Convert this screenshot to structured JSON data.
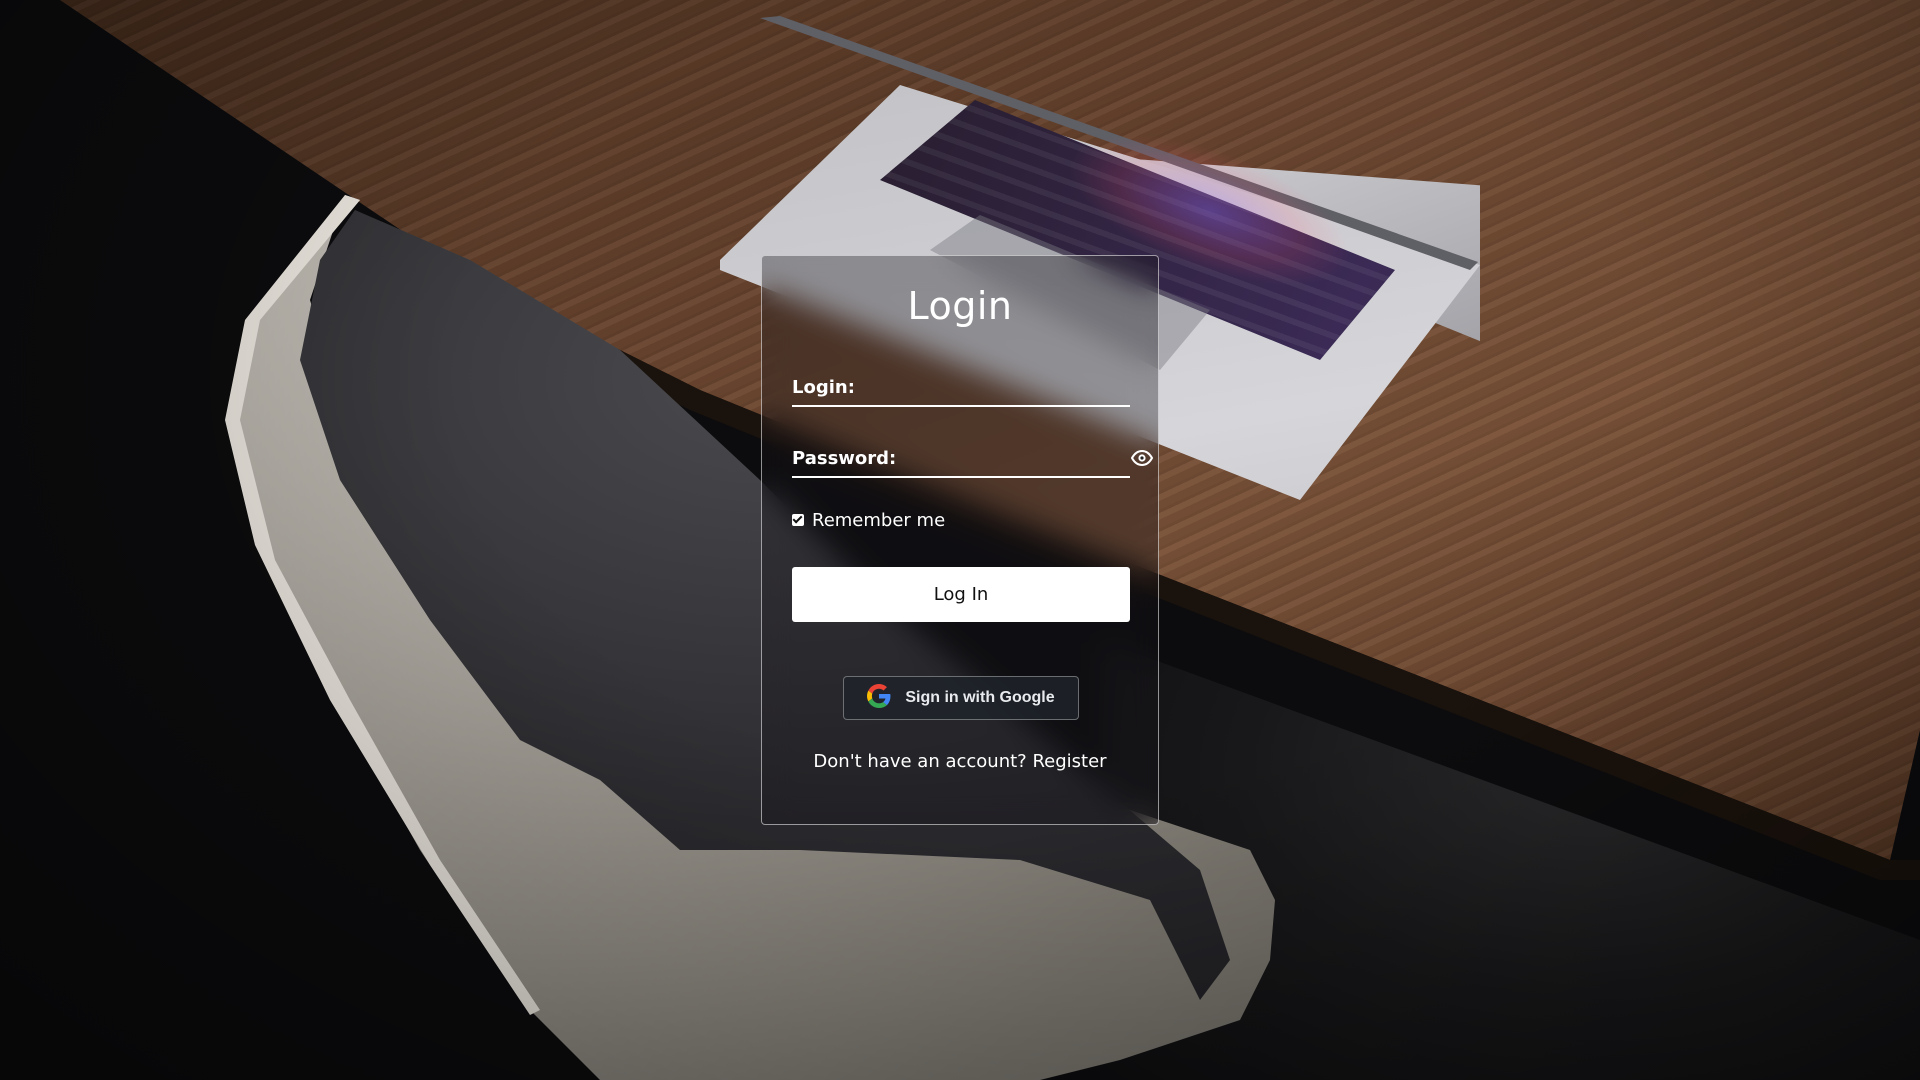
{
  "login_form": {
    "title": "Login",
    "login_label": "Login:",
    "login_value": "",
    "password_label": "Password:",
    "password_value": "",
    "password_toggle_icon": "eye-icon",
    "remember_me_label": "Remember me",
    "remember_me_checked": true,
    "submit_label": "Log In",
    "google_button_label": "Sign in with Google",
    "google_icon": "google-logo-icon",
    "register_prompt": "Don't have an account?",
    "register_link": "Register"
  },
  "colors": {
    "card_border": "#ffffff",
    "button_bg": "#ffffff",
    "button_text": "#111111",
    "google_button_bg": "#1e242a",
    "text": "#ffffff"
  }
}
